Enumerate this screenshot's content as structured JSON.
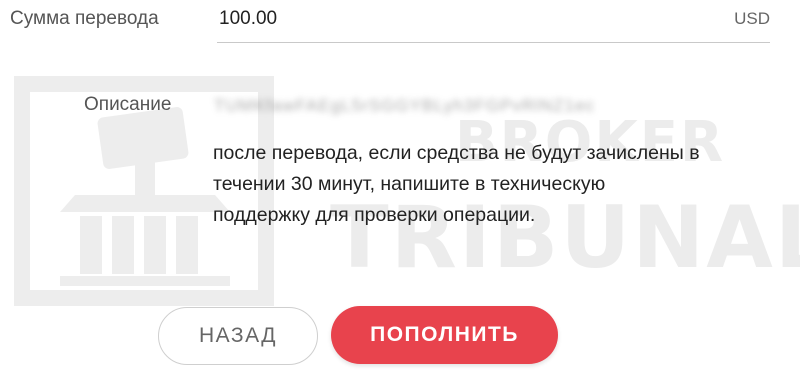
{
  "watermark": {
    "broker": "BROKER",
    "tribunal": "TRIBUNAL"
  },
  "amount": {
    "label": "Сумма перевода",
    "value": "100.00",
    "currency": "USD"
  },
  "description": {
    "label": "Описание",
    "lines": [
      "после перевода, если средства не будут зачислены в",
      "течении 30 минут, напишите в техническую",
      "поддержку для проверки операции."
    ]
  },
  "buttons": {
    "back": "НАЗАД",
    "topup": "ПОПОЛНИТЬ"
  },
  "colors": {
    "accent": "#e8434d",
    "watermark": "#ececec"
  }
}
